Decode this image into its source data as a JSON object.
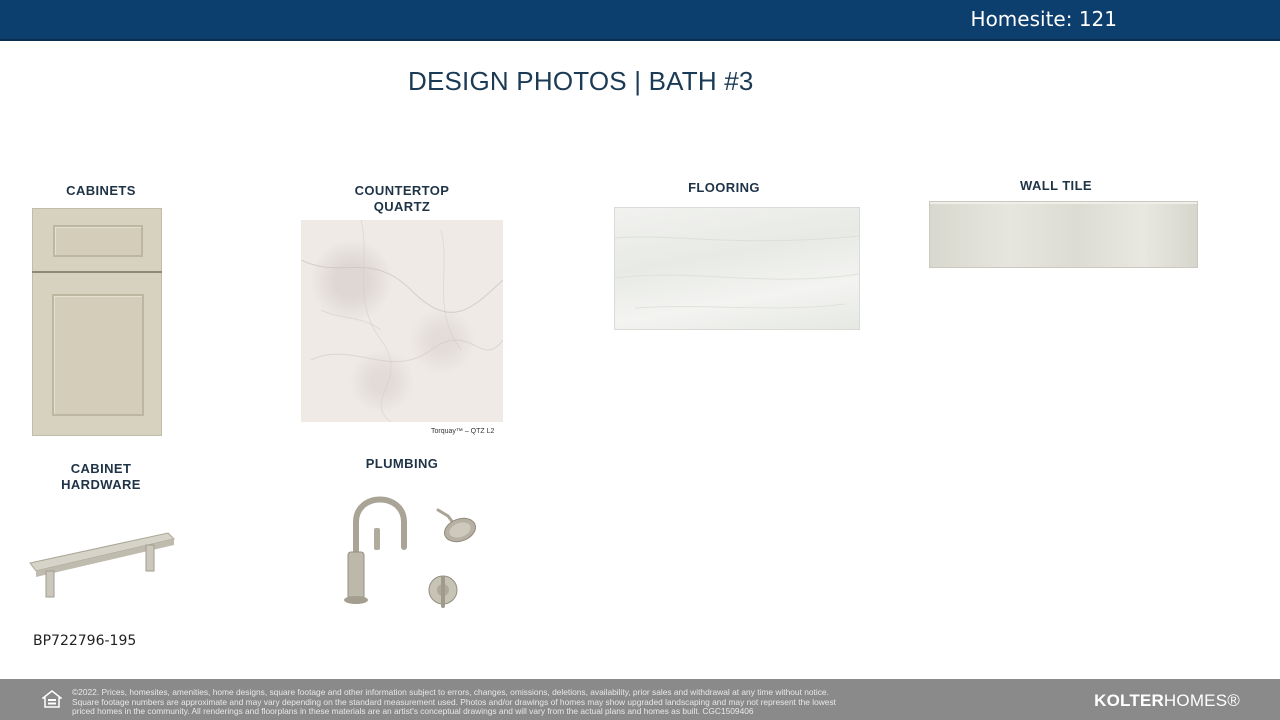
{
  "header": {
    "homesite": "Homesite: 121"
  },
  "title": "DESIGN PHOTOS | BATH #3",
  "sections": {
    "cabinets": "CABINETS",
    "countertop": [
      "COUNTERTOP",
      "QUARTZ"
    ],
    "countertop_caption": "Torquay™ – QTZ L2",
    "flooring": "FLOORING",
    "wall_tile": "WALL TILE",
    "cabinet_hardware": [
      "CABINET",
      "HARDWARE"
    ],
    "hardware_sku": "BP722796-195",
    "plumbing": "PLUMBING"
  },
  "footer": {
    "disclaimer_line1": "©2022. Prices, homesites, amenities, home designs, square footage and other information subject to errors, changes, omissions, deletions, availability, prior sales and withdrawal at any time without notice.",
    "disclaimer_line2": "Square footage numbers are approximate and may vary depending on the standard measurement used. Photos and/or drawings of homes may show upgraded landscaping and may not represent the lowest",
    "disclaimer_line3": "priced homes in the community. All renderings and floorplans in these materials are an artist's conceptual drawings and will vary from the actual plans and homes as built. CGC1509406",
    "brand_bold": "KOLTER",
    "brand_light": "HOMES®"
  },
  "icons": {
    "footer": "equal-housing-icon"
  }
}
